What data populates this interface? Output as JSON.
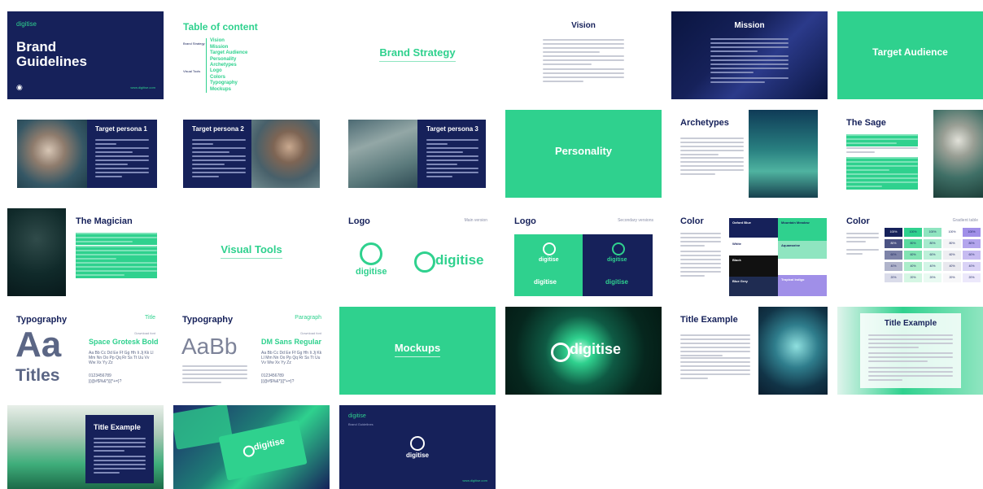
{
  "slides": {
    "cover": {
      "brand": "digitise",
      "title_line1": "Brand",
      "title_line2": "Guidelines",
      "footer": "www.digitise.com"
    },
    "toc": {
      "title": "Table of content",
      "group1_label": "Brand Strategy",
      "group1_items": [
        "Vision",
        "Mission",
        "Target Audience",
        "Personality",
        "Archetypes"
      ],
      "group2_label": "Visual Tools",
      "group2_items": [
        "Logo",
        "Colors",
        "Typography",
        "Mockups"
      ]
    },
    "brand_strategy": {
      "title": "Brand Strategy"
    },
    "vision": {
      "title": "Vision"
    },
    "mission": {
      "title": "Mission"
    },
    "target_audience": {
      "title": "Target Audience"
    },
    "persona1": {
      "title": "Target persona 1"
    },
    "persona2": {
      "title": "Target persona 2"
    },
    "persona3": {
      "title": "Target persona 3"
    },
    "personality": {
      "title": "Personality"
    },
    "archetypes": {
      "title": "Archetypes"
    },
    "sage": {
      "title": "The Sage"
    },
    "magician": {
      "title": "The Magician"
    },
    "visual_tools": {
      "title": "Visual Tools"
    },
    "logo_main": {
      "title": "Logo",
      "tag": "Main version",
      "wordmark": "digitise"
    },
    "logo_secondary": {
      "title": "Logo",
      "tag": "Secondary versions",
      "wordmark": "digitise"
    },
    "color1": {
      "title": "Color",
      "swatches": [
        {
          "name": "Oxford Blue",
          "color": "#16215a",
          "text": "#ffffff"
        },
        {
          "name": "Mountain Meadow",
          "color": "#2fd18e",
          "text": "#16215a"
        },
        {
          "name": "White",
          "color": "#ffffff",
          "text": "#16215a"
        },
        {
          "name": "Aquamarine",
          "color": "#8fe5c0",
          "text": "#16215a"
        },
        {
          "name": "Black",
          "color": "#111111",
          "text": "#ffffff"
        },
        {
          "name": "Blue Grey",
          "color": "#1f2c52",
          "text": "#ffffff"
        },
        {
          "name": "Tropical Indigo",
          "color": "#a08fe8",
          "text": "#ffffff"
        }
      ]
    },
    "color2": {
      "title": "Color",
      "tag": "Gradient table",
      "row_labels": [
        "100%",
        "80%",
        "60%",
        "40%",
        "20%"
      ],
      "row_colors": [
        "#16215a",
        "#4b5384",
        "#7d83a8",
        "#b0b4cb",
        "#dadcea"
      ],
      "col_colors": [
        "#2fd18e",
        "#8fe5c0",
        "#ffffff",
        "#a08fe8"
      ]
    },
    "typo1": {
      "title": "Typography",
      "tag": "Title",
      "big": "Aa",
      "big2": "Titles",
      "font_label": "Download font",
      "font_name": "Space Grotesk Bold",
      "glyphs": "Aa Bb Cc Dd Ee Ff Gg Hh Ii Jj Kk Ll Mm Nn Oo Pp Qq Rr Ss Tt Uu Vv Ww Xx Yy Zz",
      "nums": "0123456789",
      "symbols": "[(@#$%&*)]{*+=}?"
    },
    "typo2": {
      "title": "Typography",
      "tag": "Paragraph",
      "big": "AaBb",
      "font_label": "Download font",
      "font_name": "DM Sans Regular",
      "glyphs": "Aa Bb Cc Dd Ee Ff Gg Hh Ii Jj Kk Ll Mm Nn Oo Pp Qq Rr Ss Tt Uu Vv Ww Xx Yy Zz",
      "nums": "0123456789",
      "symbols": "[(@#$%&*)]{*+=}?"
    },
    "mockups": {
      "title": "Mockups"
    },
    "hero_logo": {
      "wordmark": "digitise"
    },
    "title_ex1": {
      "title": "Title Example"
    },
    "title_ex2": {
      "title": "Title Example"
    },
    "title_ex3": {
      "title": "Title Example"
    },
    "mock_cards": {
      "wordmark": "digitise"
    },
    "closing": {
      "brand": "digitise",
      "subtitle": "Brand Guidelines",
      "wordmark": "digitise",
      "footer": "www.digitise.com"
    }
  },
  "colors": {
    "navy": "#16215a",
    "green": "#2fd18e",
    "mint": "#8fe5c0",
    "white": "#ffffff"
  }
}
